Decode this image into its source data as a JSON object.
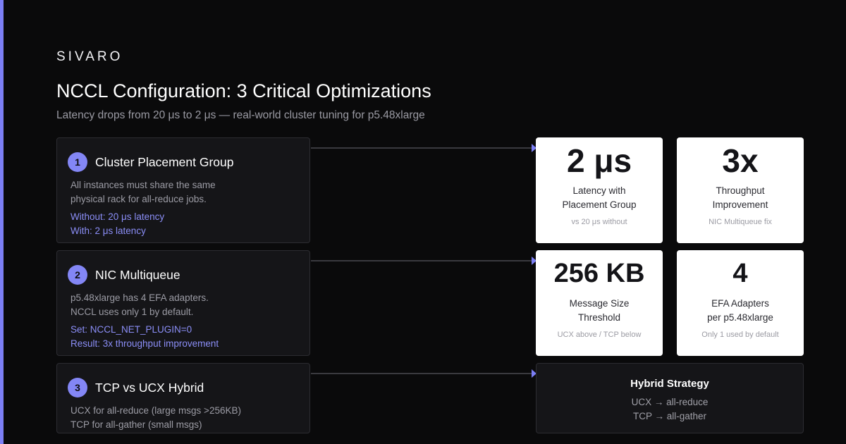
{
  "brand": "SIVARO",
  "title": "NCCL Configuration: 3 Critical Optimizations",
  "subtitle": "Latency drops from 20 μs to 2 μs — real-world cluster tuning for p5.48xlarge",
  "steps": [
    {
      "number": "1",
      "title": "Cluster Placement Group",
      "desc": [
        "All instances must share the same",
        "physical rack for all-reduce jobs."
      ],
      "highlights": [
        "Without: 20 μs latency",
        "With: 2 μs latency"
      ]
    },
    {
      "number": "2",
      "title": "NIC Multiqueue",
      "desc": [
        "p5.48xlarge has 4 EFA adapters.",
        "NCCL uses only 1 by default."
      ],
      "highlights": [
        "Set: NCCL_NET_PLUGIN=0",
        "Result: 3x throughput improvement"
      ]
    },
    {
      "number": "3",
      "title": "TCP vs UCX Hybrid",
      "desc": [
        "UCX for all-reduce (large msgs >256KB)",
        "TCP for all-gather (small msgs)"
      ],
      "highlights": []
    }
  ],
  "stats": [
    {
      "value": "2 μs",
      "label": [
        "Latency with",
        "Placement Group"
      ],
      "note": "vs 20 μs without"
    },
    {
      "value": "3x",
      "label": [
        "Throughput",
        "Improvement"
      ],
      "note": "NIC Multiqueue fix"
    },
    {
      "value": "256 KB",
      "label": [
        "Message Size",
        "Threshold"
      ],
      "note": "UCX above / TCP below"
    },
    {
      "value": "4",
      "label": [
        "EFA Adapters",
        "per p5.48xlarge"
      ],
      "note": "Only 1 used by default"
    }
  ],
  "hybrid": {
    "title": "Hybrid Strategy",
    "lines": [
      "UCX → all-reduce",
      "TCP → all-gather"
    ]
  },
  "colors": {
    "accent": "#7c7ff5",
    "background": "#0a0a0b",
    "card": "#151518",
    "highlight_text": "#8b8ef7"
  }
}
